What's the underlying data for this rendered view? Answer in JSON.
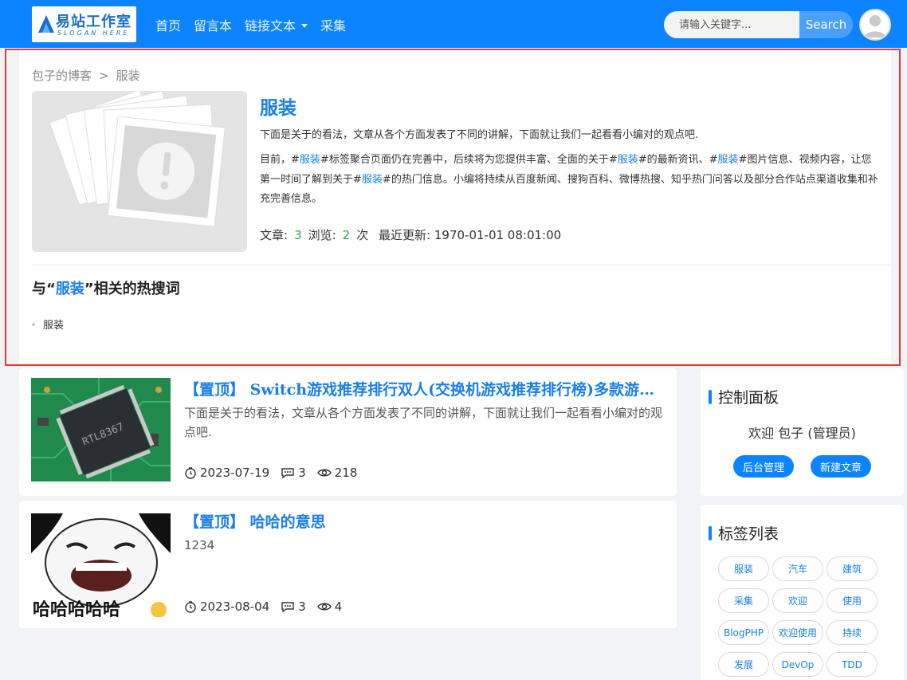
{
  "header": {
    "logo": {
      "title": "易站工作室",
      "slogan": "SLOGAN HERE"
    },
    "nav": [
      {
        "label": "首页"
      },
      {
        "label": "留言本"
      },
      {
        "label": "链接文本",
        "has_dropdown": true
      },
      {
        "label": "采集"
      }
    ],
    "search": {
      "placeholder": "请输入关键字...",
      "button": "Search"
    },
    "avatar_icon": "user-avatar-icon"
  },
  "tag_page": {
    "breadcrumb": {
      "home": "包子的博客",
      "separator": ">",
      "current": "服装"
    },
    "title": "服装",
    "desc_intro": "下面是关于的看法，文章从各个方面发表了不同的讲解，下面就让我们一起看看小编对的观点吧.",
    "desc": {
      "p1": "目前，#",
      "kw1": "服装",
      "p2": "#标签聚合页面仍在完善中，后续将为您提供丰富、全面的关于#",
      "kw2": "服装",
      "p3": "#的最新资讯、#",
      "kw3": "服装",
      "p4": "#图片信息、视频内容，让您第一时间了解到关于#",
      "kw4": "服装",
      "p5": "#的热门信息。小编将持续从百度新闻、搜狗百科、微博热搜、知乎热门问答以及部分合作站点渠道收集和补充完善信息。"
    },
    "stats": {
      "articles_label": "文章:",
      "articles": "3",
      "views_label": "浏览:",
      "views": "2",
      "views_unit": "次",
      "updated_label": "最近更新:",
      "updated": "1970-01-01 08:01:00"
    },
    "hot": {
      "title_prefix": "与“",
      "title_kw": "服装",
      "title_suffix": "”相关的热搜词",
      "items": [
        "服装"
      ]
    }
  },
  "posts": [
    {
      "title": "【置顶】 Switch游戏推荐排行双人(交换机游戏推荐排行榜)多款游戏推荐",
      "excerpt": "下面是关于的看法，文章从各个方面发表了不同的讲解，下面就让我们一起看看小编对的观点吧.",
      "date": "2023-07-19",
      "comments": "3",
      "views": "218",
      "thumb_text": "RTL8367"
    },
    {
      "title": "【置顶】 哈哈的意思",
      "excerpt": "1234",
      "date": "2023-08-04",
      "comments": "3",
      "views": "4",
      "thumb_text": "哈哈哈哈哈"
    }
  ],
  "sidebar": {
    "control": {
      "title": "控制面板",
      "welcome": "欢迎 包子 (管理员)",
      "admin_btn": "后台管理",
      "new_btn": "新建文章"
    },
    "tags": {
      "title": "标签列表",
      "items": [
        "服装",
        "汽车",
        "建筑",
        "采集",
        "欢迎",
        "使用",
        "BlogPHP",
        "欢迎使用",
        "持续",
        "发展",
        "DevOp",
        "TDD"
      ]
    }
  },
  "colors": {
    "primary": "#0d84ff",
    "link": "#1a7fe8",
    "highlight_border": "#e53935",
    "stat_green": "#2ea44f"
  }
}
